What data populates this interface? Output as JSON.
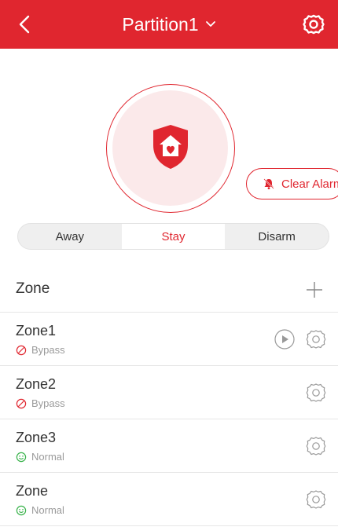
{
  "header": {
    "title": "Partition1",
    "back_icon": "back-chevron-icon",
    "dropdown_icon": "chevron-down-icon",
    "settings_icon": "gear-icon",
    "color": "#e0262f"
  },
  "status": {
    "state_icon": "home-shield-icon",
    "clear_alarm_label": "Clear Alarm",
    "clear_alarm_icon": "alarm-bell-icon"
  },
  "modes": {
    "items": [
      {
        "label": "Away"
      },
      {
        "label": "Stay"
      },
      {
        "label": "Disarm"
      }
    ],
    "selected": "Stay"
  },
  "zones": {
    "title": "Zone",
    "add_icon": "plus-icon",
    "items": [
      {
        "name": "Zone1",
        "status": "Bypass",
        "status_icon": "bypass-icon",
        "has_play": true
      },
      {
        "name": "Zone2",
        "status": "Bypass",
        "status_icon": "bypass-icon",
        "has_play": false
      },
      {
        "name": "Zone3",
        "status": "Normal",
        "status_icon": "smile-icon",
        "has_play": false
      },
      {
        "name": "Zone",
        "status": "Normal",
        "status_icon": "smile-icon",
        "has_play": false
      }
    ]
  },
  "colors": {
    "accent": "#e0262f",
    "normal_green": "#38b24a",
    "muted": "#9a9a9a"
  }
}
